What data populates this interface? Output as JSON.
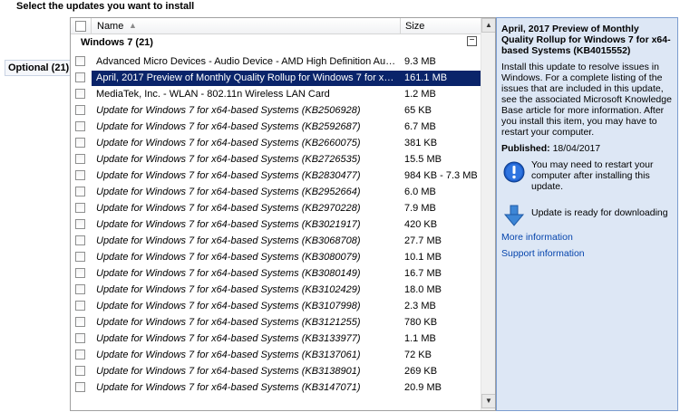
{
  "page_title": "Select the updates you want to install",
  "left_tab": {
    "label": "Optional (21)"
  },
  "columns": {
    "name": "Name",
    "size": "Size"
  },
  "group": {
    "label": "Windows 7 (21)"
  },
  "updates": [
    {
      "name": "Advanced Micro Devices - Audio Device - AMD High Definition Aud...",
      "size": "9.3 MB",
      "italic": false,
      "selected": false
    },
    {
      "name": "April, 2017 Preview of Monthly Quality Rollup for Windows 7 for x64...",
      "size": "161.1 MB",
      "italic": false,
      "selected": true
    },
    {
      "name": "MediaTek, Inc. - WLAN - 802.11n Wireless LAN Card",
      "size": "1.2 MB",
      "italic": false,
      "selected": false
    },
    {
      "name": "Update for Windows 7 for x64-based Systems (KB2506928)",
      "size": "65 KB",
      "italic": true,
      "selected": false
    },
    {
      "name": "Update for Windows 7 for x64-based Systems (KB2592687)",
      "size": "6.7 MB",
      "italic": true,
      "selected": false
    },
    {
      "name": "Update for Windows 7 for x64-based Systems (KB2660075)",
      "size": "381 KB",
      "italic": true,
      "selected": false
    },
    {
      "name": "Update for Windows 7 for x64-based Systems (KB2726535)",
      "size": "15.5 MB",
      "italic": true,
      "selected": false
    },
    {
      "name": "Update for Windows 7 for x64-based Systems (KB2830477)",
      "size": "984 KB - 7.3 MB",
      "italic": true,
      "selected": false
    },
    {
      "name": "Update for Windows 7 for x64-based Systems (KB2952664)",
      "size": "6.0 MB",
      "italic": true,
      "selected": false
    },
    {
      "name": "Update for Windows 7 for x64-based Systems (KB2970228)",
      "size": "7.9 MB",
      "italic": true,
      "selected": false
    },
    {
      "name": "Update for Windows 7 for x64-based Systems (KB3021917)",
      "size": "420 KB",
      "italic": true,
      "selected": false
    },
    {
      "name": "Update for Windows 7 for x64-based Systems (KB3068708)",
      "size": "27.7 MB",
      "italic": true,
      "selected": false
    },
    {
      "name": "Update for Windows 7 for x64-based Systems (KB3080079)",
      "size": "10.1 MB",
      "italic": true,
      "selected": false
    },
    {
      "name": "Update for Windows 7 for x64-based Systems (KB3080149)",
      "size": "16.7 MB",
      "italic": true,
      "selected": false
    },
    {
      "name": "Update for Windows 7 for x64-based Systems (KB3102429)",
      "size": "18.0 MB",
      "italic": true,
      "selected": false
    },
    {
      "name": "Update for Windows 7 for x64-based Systems (KB3107998)",
      "size": "2.3 MB",
      "italic": true,
      "selected": false
    },
    {
      "name": "Update for Windows 7 for x64-based Systems (KB3121255)",
      "size": "780 KB",
      "italic": true,
      "selected": false
    },
    {
      "name": "Update for Windows 7 for x64-based Systems (KB3133977)",
      "size": "1.1 MB",
      "italic": true,
      "selected": false
    },
    {
      "name": "Update for Windows 7 for x64-based Systems (KB3137061)",
      "size": "72 KB",
      "italic": true,
      "selected": false
    },
    {
      "name": "Update for Windows 7 for x64-based Systems (KB3138901)",
      "size": "269 KB",
      "italic": true,
      "selected": false
    },
    {
      "name": "Update for Windows 7 for x64-based Systems (KB3147071)",
      "size": "20.9 MB",
      "italic": true,
      "selected": false
    }
  ],
  "details": {
    "title": "April, 2017 Preview of Monthly Quality Rollup for Windows 7 for x64-based Systems (KB4015552)",
    "description": "Install this update to resolve issues in Windows. For a complete listing of the issues that are included in this update, see the associated Microsoft Knowledge Base article for more information. After you install this item, you may have to restart your computer.",
    "published_label": "Published:",
    "published_date": "18/04/2017",
    "restart_notice": "You may need to restart your computer after installing this update.",
    "ready_status": "Update is ready for downloading",
    "more_info_link": "More information",
    "support_info_link": "Support information"
  },
  "icons": {
    "sort": "sort-ascending-icon",
    "collapse": "collapse-icon",
    "info": "info-icon",
    "download": "download-arrow-icon"
  },
  "colors": {
    "selection": "#0a246a",
    "details_bg": "#dde7f5",
    "link": "#0645ad"
  }
}
